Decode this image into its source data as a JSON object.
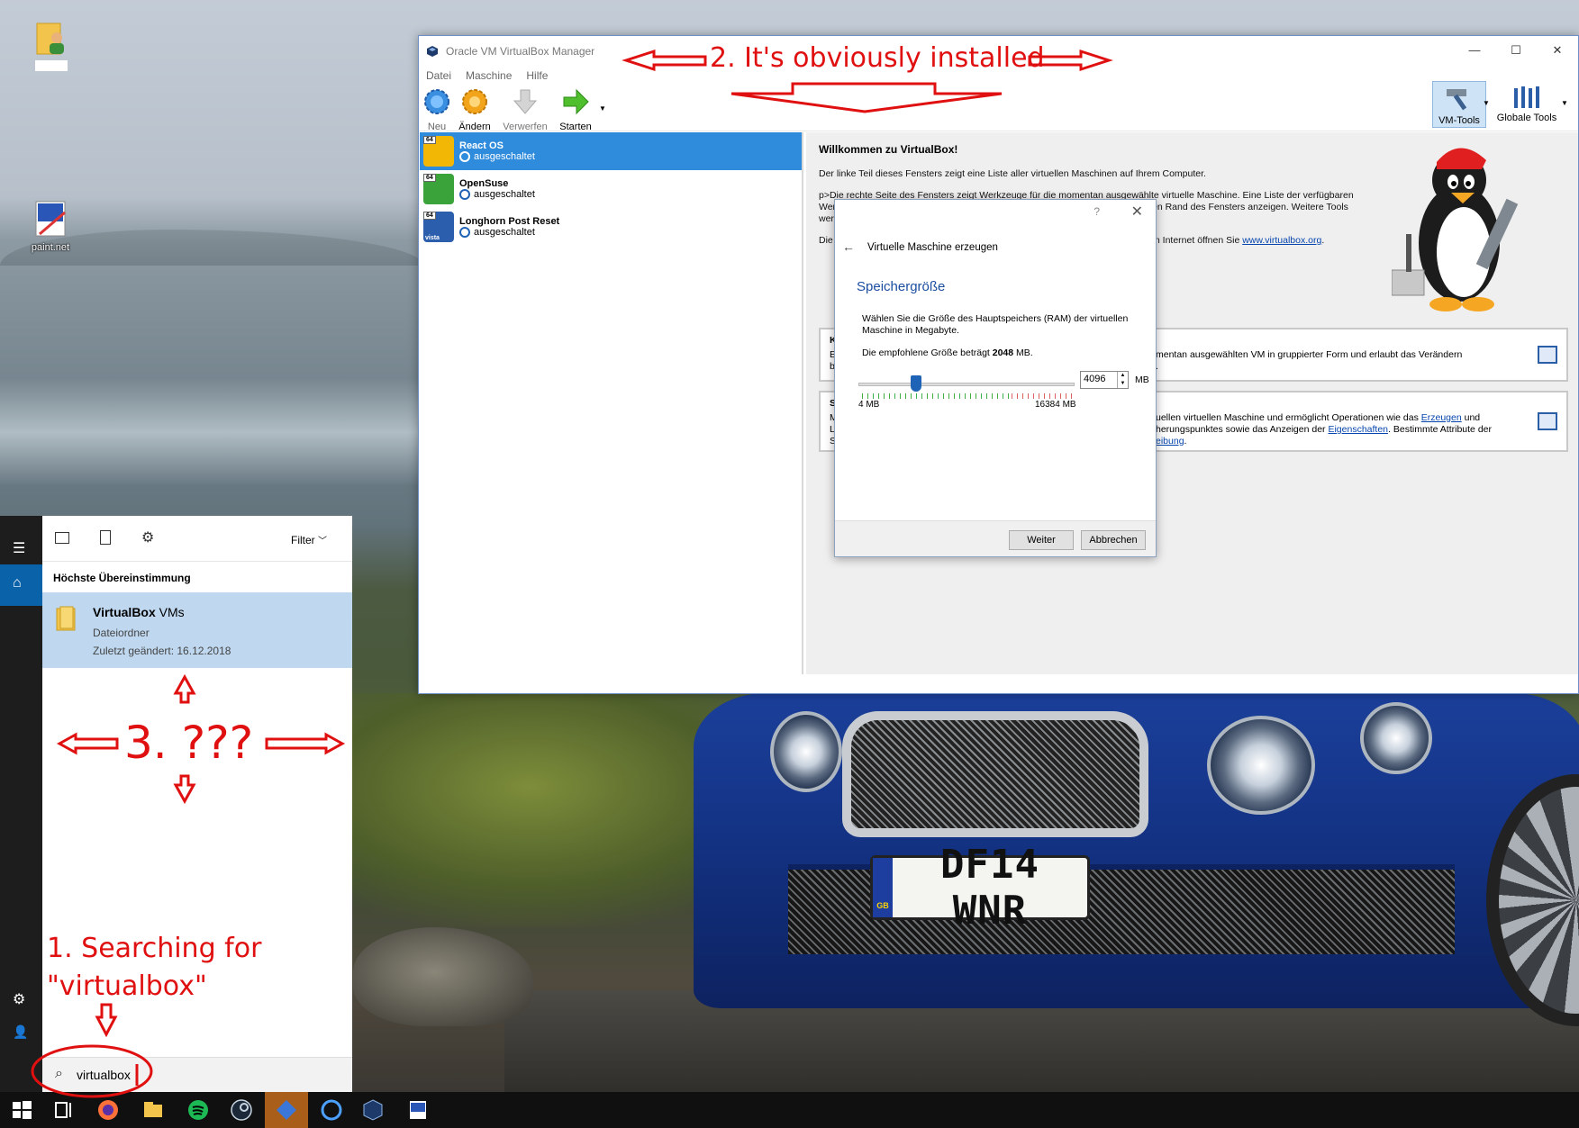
{
  "desktop": {
    "icons": [
      {
        "label": ""
      },
      {
        "label": "paint.net"
      }
    ]
  },
  "vbox": {
    "title": "Oracle VM VirtualBox Manager",
    "window_controls": {
      "minimize": "—",
      "maximize": "☐",
      "close": "✕"
    },
    "menu": [
      "Datei",
      "Maschine",
      "Hilfe"
    ],
    "toolbar": [
      {
        "label": "Neu",
        "icon": "new-gear-icon"
      },
      {
        "label": "Ändern",
        "icon": "settings-gear-icon"
      },
      {
        "label": "Verwerfen",
        "icon": "discard-arrow-icon"
      },
      {
        "label": "Starten",
        "icon": "start-arrow-icon"
      }
    ],
    "vm_tools_label": "VM-Tools",
    "global_tools_label": "Globale Tools",
    "vms": [
      {
        "name": "React OS",
        "state": "ausgeschaltet",
        "selected": true,
        "badge": "64",
        "color": "#f2b705"
      },
      {
        "name": "OpenSuse",
        "state": "ausgeschaltet",
        "selected": false,
        "badge": "64",
        "color": "#3aa33a"
      },
      {
        "name": "Longhorn Post Reset",
        "state": "ausgeschaltet",
        "selected": false,
        "badge": "64",
        "sub_badge": "vista",
        "color": "#2b5fae"
      }
    ],
    "welcome": {
      "title": "Willkommen zu VirtualBox!",
      "p1": "Der linke Teil dieses Fensters zeigt eine Liste aller virtuellen Maschinen auf Ihrem Computer.",
      "p2_line1": "p>Die rechte Seite des Fensters zeigt Werkzeuge für die momentan ausgewählte virtuelle Maschine. Eine Liste der verfügbaren",
      "p2_line2_a": "Wer",
      "p2_line2_b": "en Rand des Fensters anzeigen. Weitere Tools",
      "p2_line3": "wer",
      "p3_a": "Die",
      "p3_b": "m Internet öffnen Sie ",
      "p3_link": "www.virtualbox.org",
      "p3_end": "."
    },
    "card1": {
      "title_frag": "K",
      "frag_a": "E",
      "frag_b": "b",
      "text": "mentan ausgewählten VM in gruppierter Form und erlaubt das Verändern",
      "text2": "."
    },
    "card2": {
      "title_frag": "S",
      "frag_a": "M",
      "frag_b": "L",
      "frag_c": "S",
      "line1_a": "uellen virtuellen Maschine und ermöglicht Operationen wie das ",
      "line1_link": "Erzeugen",
      "line1_b": " und",
      "line2_a": "herungspunktes sowie das Anzeigen der ",
      "line2_link": "Eigenschaften",
      "line2_b": ". Bestimmte Attribute der",
      "line3_link": "eibung",
      "line3_b": "."
    }
  },
  "wizard": {
    "help": "?",
    "close": "✕",
    "back": "←",
    "title": "Virtuelle Maschine erzeugen",
    "heading": "Speichergröße",
    "description": "Wählen Sie die Größe des Hauptspeichers (RAM) der virtuellen Maschine in Megabyte.",
    "recommend_prefix": "Die empfohlene Größe beträgt ",
    "recommend_value": "2048",
    "recommend_suffix": " MB.",
    "memory_value": "4096",
    "memory_unit": "MB",
    "min_label": "4 MB",
    "max_label": "16384 MB",
    "slider_fraction": 0.25,
    "next": "Weiter",
    "cancel": "Abbrechen"
  },
  "start_menu": {
    "filter_label": "Filter",
    "best_match_header": "Höchste Übereinstimmung",
    "result": {
      "title_bold": "VirtualBox",
      "title_rest": " VMs",
      "type": "Dateiordner",
      "modified": "Zuletzt geändert: 16.12.2018"
    },
    "search_query": "virtualbox"
  },
  "taskbar": {
    "icons": [
      "windows-start-icon",
      "task-view-icon",
      "firefox-icon",
      "file-explorer-icon",
      "spotify-icon",
      "steam-icon",
      "app-icon",
      "cortana-icon",
      "virtualbox-icon",
      "paintnet-icon"
    ]
  },
  "annotations": {
    "a2": "2. It's obviously installed",
    "a3": "3. ???",
    "a1_line1": "1. Searching for",
    "a1_line2": "\"virtualbox\""
  },
  "colors": {
    "selection_blue": "#2f8bdc",
    "annotation_red": "#e01010",
    "start_accent": "#0a62a9",
    "wizard_heading": "#1b4ea0"
  }
}
